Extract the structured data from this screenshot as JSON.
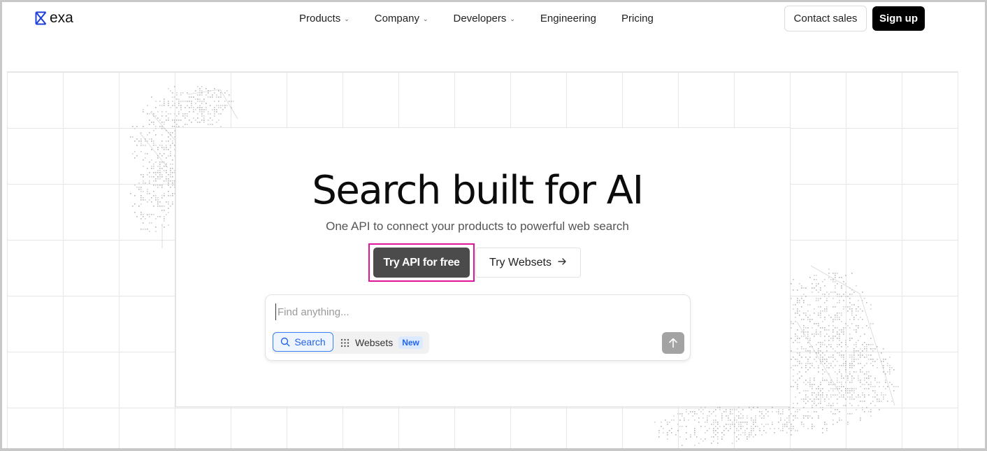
{
  "header": {
    "logo_text": "exa",
    "nav": [
      {
        "label": "Products",
        "has_dropdown": true
      },
      {
        "label": "Company",
        "has_dropdown": true
      },
      {
        "label": "Developers",
        "has_dropdown": true
      },
      {
        "label": "Engineering",
        "has_dropdown": false
      },
      {
        "label": "Pricing",
        "has_dropdown": false
      }
    ],
    "contact_sales": "Contact sales",
    "sign_up": "Sign up"
  },
  "hero": {
    "title": "Search built for AI",
    "subtitle": "One API to connect your products to powerful web search",
    "primary_cta": "Try API for free",
    "secondary_cta": "Try Websets",
    "secondary_cta_icon": "arrow-right-icon"
  },
  "search": {
    "placeholder": "Find anything...",
    "value": "",
    "modes": [
      {
        "label": "Search",
        "icon": "search-icon",
        "selected": true
      },
      {
        "label": "Websets",
        "icon": "grid-dots-icon",
        "selected": false,
        "badge": "New"
      }
    ],
    "submit_icon": "arrow-up-icon"
  },
  "colors": {
    "accent_blue": "#2563eb",
    "highlight_pink": "#e0169a",
    "primary_button": "#4b4b4b",
    "logo_blue": "#1f3fd8"
  }
}
